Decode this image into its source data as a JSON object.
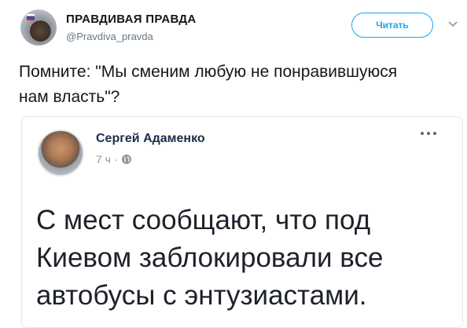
{
  "tweet": {
    "author_name": "ПРАВДИВАЯ ПРАВДА",
    "author_handle": "@Pravdiva_pravda",
    "follow_label": "Читать",
    "text": "Помните: \"Мы сменим любую не понравившуюся нам власть\"?",
    "avatar_icon": "bear-avatar",
    "menu_icon": "chevron-down-icon"
  },
  "quote": {
    "author_name": "Сергей Адаменко",
    "time": "7 ч",
    "separator": "·",
    "privacy_icon": "globe-icon",
    "more_icon": "more-dots-icon",
    "text": "С мест сообщают, что под Киевом заблокировали все автобусы с энтузиастами."
  },
  "colors": {
    "accent": "#1da1f2",
    "facebook_name": "#1c2b48",
    "muted": "#657786"
  }
}
